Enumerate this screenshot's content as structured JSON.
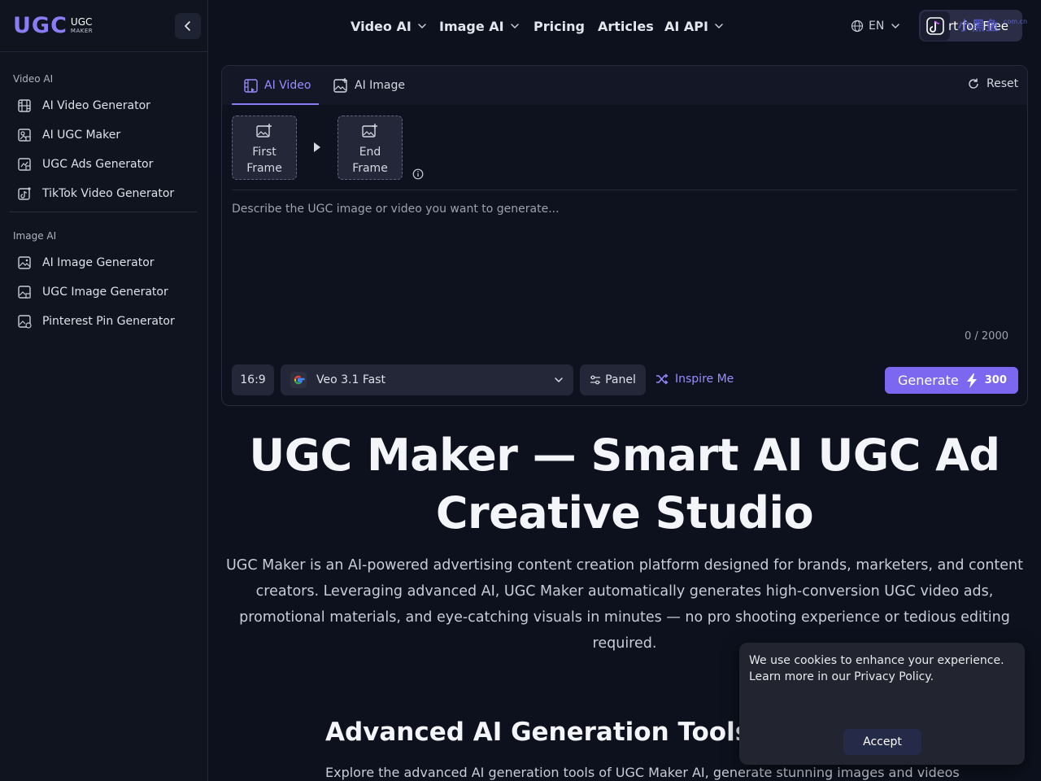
{
  "brand": {
    "name": "UGC",
    "sub_line1": "UGC",
    "sub_line2": "MAKER"
  },
  "sidebar": {
    "sections": [
      {
        "label": "Video AI",
        "items": [
          {
            "label": "AI Video Generator",
            "icon": "film-icon"
          },
          {
            "label": "AI UGC Maker",
            "icon": "ugc-maker-icon"
          },
          {
            "label": "UGC Ads Generator",
            "icon": "ads-icon"
          },
          {
            "label": "TikTok Video Generator",
            "icon": "tiktok-icon"
          }
        ]
      },
      {
        "label": "Image AI",
        "items": [
          {
            "label": "AI Image Generator",
            "icon": "image-icon"
          },
          {
            "label": "UGC Image Generator",
            "icon": "ugc-image-icon"
          },
          {
            "label": "Pinterest Pin Generator",
            "icon": "pinterest-icon"
          }
        ]
      }
    ]
  },
  "nav": {
    "items": [
      {
        "label": "Video AI",
        "dropdown": true
      },
      {
        "label": "Image AI",
        "dropdown": true
      },
      {
        "label": "Pricing",
        "dropdown": false
      },
      {
        "label": "Articles",
        "dropdown": false
      },
      {
        "label": "AI API",
        "dropdown": true
      }
    ],
    "language": "EN",
    "cta_label": "rt for Free",
    "watermark": "小黑鱼",
    "watermark_sub": "com.cn"
  },
  "generator": {
    "tabs": [
      {
        "label": "AI Video",
        "active": true
      },
      {
        "label": "AI Image",
        "active": false
      }
    ],
    "reset_label": "Reset",
    "first_frame_label": "First Frame",
    "end_frame_label": "End Frame",
    "prompt_placeholder": "Describe the UGC image or video you want to generate...",
    "prompt_value": "",
    "counter": "0 / 2000",
    "aspect_ratio": "16:9",
    "model": "Veo 3.1 Fast",
    "panel_label": "Panel",
    "inspire_label": "Inspire Me",
    "generate_label": "Generate",
    "generate_cost": "300"
  },
  "hero": {
    "title": "UGC Maker — Smart AI UGC Ad Creative Studio",
    "description": "UGC Maker is an AI-powered advertising content creation platform designed for brands, marketers, and content creators. Leveraging advanced AI, UGC Maker automatically generates high-conversion UGC video ads, promotional materials, and eye-catching visuals in minutes — no pro shooting experience or tedious editing required."
  },
  "section": {
    "title": "Advanced AI Generation Tools of",
    "description": "Explore the advanced AI generation tools of UGC Maker AI, generate stunning images and videos"
  },
  "cookie": {
    "message": "We use cookies to enhance your experience. Learn more in our Privacy Policy.",
    "accept_label": "Accept"
  },
  "colors": {
    "background": "#0d111d",
    "sidebar": "#10141f",
    "accent": "#8b7bf5",
    "generate_button": "#7c67f0",
    "control_bg": "#232737"
  }
}
